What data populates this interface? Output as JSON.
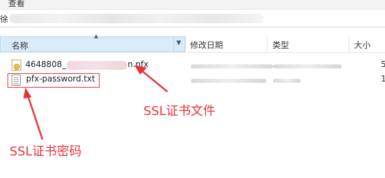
{
  "menu": {
    "label": "查看"
  },
  "address": {
    "prefix": "徐"
  },
  "columns": {
    "name": "名称",
    "modified": "修改日期",
    "type": "类型",
    "size": "大小"
  },
  "files": [
    {
      "name_prefix": "4648808_",
      "name_suffix": "n.pfx",
      "size_fragment": "5",
      "icon": "certificate-file-icon"
    },
    {
      "name": "pfx-password.txt",
      "size_fragment": "1",
      "icon": "text-file-icon"
    }
  ],
  "annotations": {
    "cert_file": "SSL证书文件",
    "cert_password": "SSL证书密码"
  },
  "colors": {
    "annotation": "#e8333a",
    "header_selected": "#d9ebf9"
  }
}
